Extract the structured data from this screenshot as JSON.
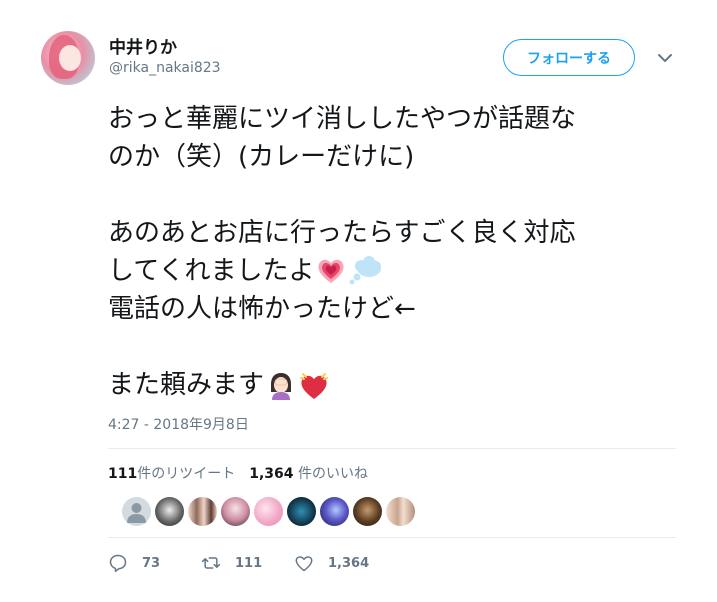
{
  "user": {
    "display_name": "中井りか",
    "handle": "@rika_nakai823"
  },
  "follow_button": {
    "label": "フォローする"
  },
  "tweet": {
    "lines": [
      "おっと華麗にツイ消ししたやつが話題な",
      "のか（笑）(カレーだけに)",
      "",
      "あのあとお店に行ったらすごく良く対応",
      "してくれましたよ",
      "電話の人は怖かったけど←",
      "",
      "また頼みます"
    ],
    "emojis": [
      "growing-heart-icon",
      "thought-balloon-icon",
      "facepalm-woman-icon",
      "beating-heart-icon"
    ],
    "timestamp": "4:27 - 2018年9月8日"
  },
  "stats": {
    "retweet_count": "111",
    "retweet_label": "件のリツイート",
    "like_count": "1,364",
    "like_label": "件のいいね"
  },
  "likers_count_shown": 9,
  "actions": {
    "reply_count": "73",
    "retweet_count": "111",
    "like_count": "1,364"
  },
  "colors": {
    "accent": "#1da1f2",
    "secondary_text": "#657786",
    "primary_text": "#14171a",
    "divider": "#e6ecf0"
  }
}
